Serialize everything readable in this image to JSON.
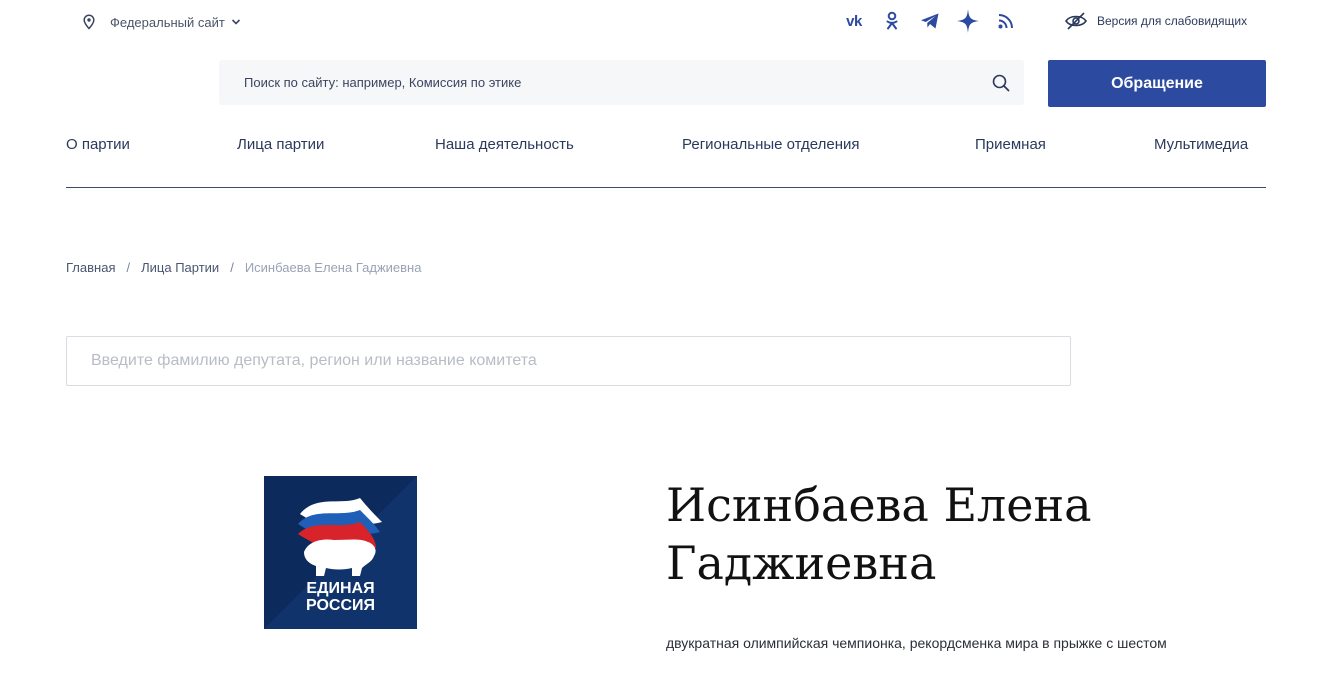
{
  "topbar": {
    "site_selector_label": "Федеральный сайт",
    "site_selector_icon": "location-pin-icon",
    "socials": [
      {
        "name": "vk",
        "icon": "vk-icon"
      },
      {
        "name": "ok",
        "icon": "odnoklassniki-icon"
      },
      {
        "name": "telegram",
        "icon": "telegram-icon"
      },
      {
        "name": "max",
        "icon": "star-icon"
      },
      {
        "name": "rss",
        "icon": "rss-icon"
      }
    ],
    "low_vision_label": "Версия для слабовидящих",
    "low_vision_icon": "eye-crossed-icon"
  },
  "search": {
    "placeholder": "Поиск по сайту: например, Комиссия по этике",
    "icon": "search-icon"
  },
  "appeal_button_label": "Обращение",
  "nav": {
    "items": [
      {
        "label": "О партии"
      },
      {
        "label": "Лица партии"
      },
      {
        "label": "Наша деятельность"
      },
      {
        "label": "Региональные отделения"
      },
      {
        "label": "Приемная"
      },
      {
        "label": "Мультимедиа"
      }
    ]
  },
  "breadcrumb": {
    "items": [
      "Главная",
      "Лица Партии"
    ],
    "current": "Исинбаева Елена Гаджиевна",
    "separator": "/"
  },
  "member_search": {
    "placeholder": "Введите фамилию депутата, регион или название комитета"
  },
  "person": {
    "name": "Исинбаева Елена Гаджиевна",
    "description": "двукратная олимпийская чемпионка, рекордсменка мира в прыжке с шестом",
    "logo_text_line1": "ЕДИНАЯ",
    "logo_text_line2": "РОССИЯ"
  },
  "colors": {
    "brand_blue": "#2c4aa0",
    "logo_bg": "#0d2a5c",
    "flag_white": "#ffffff",
    "flag_blue": "#1f5fb8",
    "flag_red": "#d8232a"
  }
}
